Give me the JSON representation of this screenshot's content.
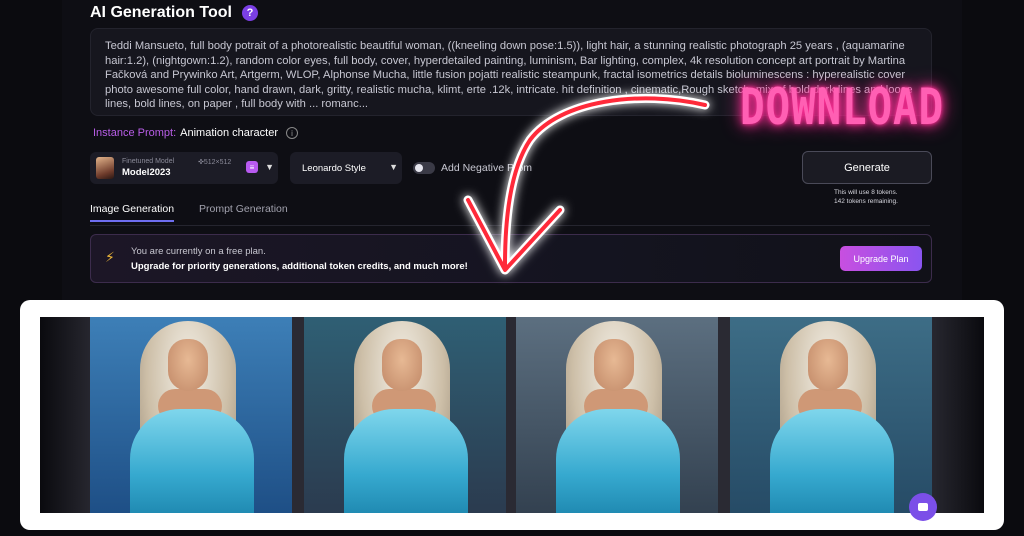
{
  "header": {
    "title": "AI Generation Tool",
    "help_icon": "help-icon"
  },
  "prompt": {
    "text": "Teddi Mansueto, full body potrait of a photorealistic beautiful woman, ((kneeling down pose:1.5)), light hair, a stunning realistic photograph 25 years , (aquamarine hair:1.2), (nightgown:1.2), random color eyes, full body, cover, hyperdetailed painting, luminism, Bar lighting,  complex, 4k resolution concept art portrait by Martina Fačková and Prywinko Art, Artgerm, WLOP, Alphonse Mucha, little fusion pojatti realistic steampunk, fractal isometrics details bioluminescens :  hyperealistic cover photo awesome full color, hand drawn, dark, gritty, realistic mucha, klimt, erte .12k, intricate. hit definition , cinematic,Rough sketch, mix of bold dark lines and loose lines, bold lines, on paper , full body with ... romanc..."
  },
  "instance": {
    "label": "Instance Prompt:",
    "value": "Animation character"
  },
  "model": {
    "sub": "Finetuned Model",
    "name": "Model2023",
    "size": "512×512"
  },
  "style": {
    "value": "Leonardo Style"
  },
  "negative_prompt": {
    "label": "Add Negative Prom",
    "enabled": false
  },
  "generate": {
    "label": "Generate",
    "tokens_line1": "This will use 8 tokens.",
    "tokens_line2": "142 tokens remaining."
  },
  "tabs": [
    {
      "label": "Image Generation",
      "active": true
    },
    {
      "label": "Prompt Generation",
      "active": false
    }
  ],
  "banner": {
    "line1": "You are currently on a free plan.",
    "line2": "Upgrade for priority generations, additional token credits, and much more!",
    "button": "Upgrade Plan"
  },
  "overlay": {
    "download_text": "DOWNLOAD",
    "accent_color": "#ff5fb3",
    "arrow_color": "#ff2a3a"
  },
  "gallery": {
    "images": [
      {
        "bg_top": "#3d7fb7",
        "bg_bottom": "#1e4f86"
      },
      {
        "bg_top": "#2f5f74",
        "bg_bottom": "#2b3b4f"
      },
      {
        "bg_top": "#5c6f80",
        "bg_bottom": "#334150"
      },
      {
        "bg_top": "#3d6d86",
        "bg_bottom": "#264b66"
      }
    ]
  }
}
